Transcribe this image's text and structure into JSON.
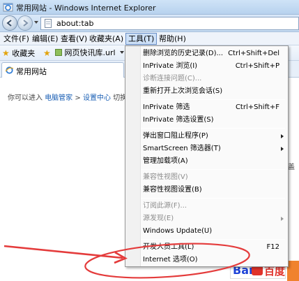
{
  "window": {
    "title": "常用网站 - Windows Internet Explorer"
  },
  "address_bar": {
    "url": "about:tab"
  },
  "menu_bar": {
    "items": [
      {
        "label": "文件(F)"
      },
      {
        "label": "编辑(E)"
      },
      {
        "label": "查看(V)"
      },
      {
        "label": "收藏夹(A)"
      },
      {
        "label": "工具(T)"
      },
      {
        "label": "帮助(H)"
      }
    ]
  },
  "favorites_bar": {
    "favorites_label": "收藏夹",
    "link_label": "网页快讯库.url"
  },
  "tabs": [
    {
      "label": "常用网站"
    }
  ],
  "content": {
    "intro_text": "你可以进入",
    "link1": "电脑管家",
    "sep1": ">",
    "link2": "设置中心",
    "tail_text": "切换为",
    "right_text": "盖",
    "logo_bai": "Bai",
    "logo_du": "百度"
  },
  "tools_menu": {
    "items": [
      {
        "label": "删除浏览的历史记录(D)...",
        "shortcut": "Ctrl+Shift+Del"
      },
      {
        "label": "InPrivate 浏览(I)",
        "shortcut": "Ctrl+Shift+P"
      },
      {
        "label": "诊断连接问题(C)..."
      },
      {
        "label": "重新打开上次浏览会话(S)"
      },
      {
        "label": "InPrivate 筛选",
        "shortcut": "Ctrl+Shift+F"
      },
      {
        "label": "InPrivate 筛选设置(S)"
      },
      {
        "label": "弹出窗口阻止程序(P)"
      },
      {
        "label": "SmartScreen 筛选器(T)"
      },
      {
        "label": "管理加载项(A)"
      },
      {
        "label": "兼容性视图(V)"
      },
      {
        "label": "兼容性视图设置(B)"
      },
      {
        "label": "订阅此源(F)..."
      },
      {
        "label": "源发现(E)"
      },
      {
        "label": "Windows Update(U)"
      },
      {
        "label": "开发人员工具(L)",
        "shortcut": "F12"
      },
      {
        "label": "Internet 选项(O)"
      }
    ]
  },
  "colors": {
    "annotation_red": "#e43b3b",
    "menu_highlight": "#cde0f7",
    "link_blue": "#1a5fb4"
  }
}
